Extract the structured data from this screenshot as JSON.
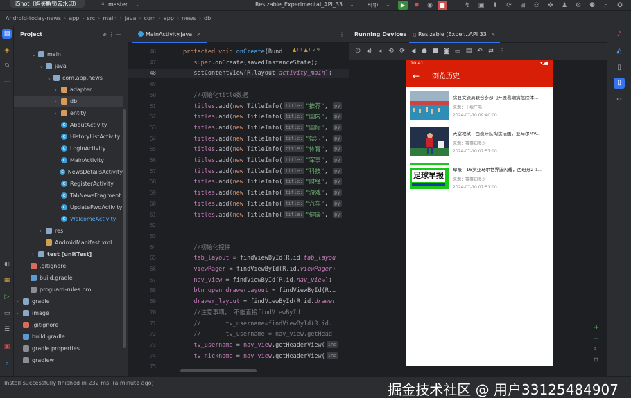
{
  "titlebar": {
    "chip": "iShot（购买解锁去水印）",
    "project_name": "Android-today-news",
    "branch": "master",
    "device": "Resizable_Experimental_API_33",
    "run_config": "app"
  },
  "breadcrumb": [
    "Android-today-news",
    "app",
    "src",
    "main",
    "java",
    "com",
    "app",
    "news",
    "db"
  ],
  "project_panel": {
    "title": "Project",
    "tree": [
      {
        "label": "main",
        "kind": "folder",
        "indent": 1,
        "open": true
      },
      {
        "label": "java",
        "kind": "folder",
        "indent": 2,
        "open": true
      },
      {
        "label": "com.app.news",
        "kind": "folder",
        "indent": 3,
        "open": true
      },
      {
        "label": "adapter",
        "kind": "folder-o",
        "indent": 4
      },
      {
        "label": "db",
        "kind": "folder-o",
        "indent": 4,
        "selected": true
      },
      {
        "label": "entity",
        "kind": "folder-o",
        "indent": 4
      },
      {
        "label": "AboutActivity",
        "kind": "class",
        "indent": 4
      },
      {
        "label": "HistoryListActivity",
        "kind": "class",
        "indent": 4
      },
      {
        "label": "LoginActivity",
        "kind": "class",
        "indent": 4
      },
      {
        "label": "MainActivity",
        "kind": "class",
        "indent": 4
      },
      {
        "label": "NewsDetailsActivity",
        "kind": "class",
        "indent": 4
      },
      {
        "label": "RegisterActivity",
        "kind": "class",
        "indent": 4
      },
      {
        "label": "TabNewsFragment",
        "kind": "class",
        "indent": 4
      },
      {
        "label": "UpdatePwdActivity",
        "kind": "class",
        "indent": 4
      },
      {
        "label": "WelcomeActivity",
        "kind": "class",
        "indent": 4,
        "accent": true
      },
      {
        "label": "res",
        "kind": "folder",
        "indent": 2
      },
      {
        "label": "AndroidManifest.xml",
        "kind": "xml",
        "indent": 2
      },
      {
        "label": "test [unitTest]",
        "kind": "folder",
        "indent": 1,
        "bold": true
      },
      {
        "label": ".gitignore",
        "kind": "git",
        "indent": 0
      },
      {
        "label": "build.gradle",
        "kind": "gradle",
        "indent": 0
      },
      {
        "label": "proguard-rules.pro",
        "kind": "txt",
        "indent": 0
      },
      {
        "label": "gradle",
        "kind": "folder",
        "indent": -1
      },
      {
        "label": "image",
        "kind": "folder",
        "indent": -1
      },
      {
        "label": ".gitignore",
        "kind": "git",
        "indent": -1
      },
      {
        "label": "build.gradle",
        "kind": "gradle",
        "indent": -1
      },
      {
        "label": "gradle.properties",
        "kind": "txt",
        "indent": -1
      },
      {
        "label": "gradlew",
        "kind": "txt",
        "indent": -1
      }
    ]
  },
  "editor": {
    "tab_label": "MainActivity.java",
    "inspection_counts": [
      "11",
      "1",
      "9"
    ],
    "lines": [
      {
        "num": "46",
        "html": "<span class='kw'>protected void</span> <span class='fn'>onCreate</span>(Bund"
      },
      {
        "num": "47",
        "html": "&nbsp;&nbsp;&nbsp;<span class='kw'>super</span>.onCreate(savedInstanceState);"
      },
      {
        "num": "48",
        "html": "&nbsp;&nbsp;&nbsp;setContentView(R.layout.<span class='it'>activity_main</span>);"
      },
      {
        "num": "49",
        "html": ""
      },
      {
        "num": "50",
        "html": "&nbsp;&nbsp;&nbsp;<span class='cmt'>//初始化title数据</span>"
      },
      {
        "num": "51",
        "html": "&nbsp;&nbsp;&nbsp;<span class='fld'>titles</span>.add(<span class='kw'>new</span> TitleInfo(<span class='hint'>title:</span><span class='str'>\"推荐\"</span>, <span class='hint'>py</span>"
      },
      {
        "num": "52",
        "html": "&nbsp;&nbsp;&nbsp;<span class='fld'>titles</span>.add(<span class='kw'>new</span> TitleInfo(<span class='hint'>title:</span><span class='str'>\"国内\"</span>, <span class='hint'>py</span>"
      },
      {
        "num": "53",
        "html": "&nbsp;&nbsp;&nbsp;<span class='fld'>titles</span>.add(<span class='kw'>new</span> TitleInfo(<span class='hint'>title:</span><span class='str'>\"国际\"</span>, <span class='hint'>py</span>"
      },
      {
        "num": "54",
        "html": "&nbsp;&nbsp;&nbsp;<span class='fld'>titles</span>.add(<span class='kw'>new</span> TitleInfo(<span class='hint'>title:</span><span class='str'>\"娱乐\"</span>, <span class='hint'>py</span>"
      },
      {
        "num": "55",
        "html": "&nbsp;&nbsp;&nbsp;<span class='fld'>titles</span>.add(<span class='kw'>new</span> TitleInfo(<span class='hint'>title:</span><span class='str'>\"体育\"</span>, <span class='hint'>py</span>"
      },
      {
        "num": "56",
        "html": "&nbsp;&nbsp;&nbsp;<span class='fld'>titles</span>.add(<span class='kw'>new</span> TitleInfo(<span class='hint'>title:</span><span class='str'>\"军事\"</span>, <span class='hint'>py</span>"
      },
      {
        "num": "57",
        "html": "&nbsp;&nbsp;&nbsp;<span class='fld'>titles</span>.add(<span class='kw'>new</span> TitleInfo(<span class='hint'>title:</span><span class='str'>\"科技\"</span>, <span class='hint'>py</span>"
      },
      {
        "num": "58",
        "html": "&nbsp;&nbsp;&nbsp;<span class='fld'>titles</span>.add(<span class='kw'>new</span> TitleInfo(<span class='hint'>title:</span><span class='str'>\"财经\"</span>, <span class='hint'>py</span>"
      },
      {
        "num": "59",
        "html": "&nbsp;&nbsp;&nbsp;<span class='fld'>titles</span>.add(<span class='kw'>new</span> TitleInfo(<span class='hint'>title:</span><span class='str'>\"游戏\"</span>, <span class='hint'>py</span>"
      },
      {
        "num": "60",
        "html": "&nbsp;&nbsp;&nbsp;<span class='fld'>titles</span>.add(<span class='kw'>new</span> TitleInfo(<span class='hint'>title:</span><span class='str'>\"汽车\"</span>, <span class='hint'>py</span>"
      },
      {
        "num": "61",
        "html": "&nbsp;&nbsp;&nbsp;<span class='fld'>titles</span>.add(<span class='kw'>new</span> TitleInfo(<span class='hint'>title:</span><span class='str'>\"健康\"</span>, <span class='hint'>py</span>"
      },
      {
        "num": "62",
        "html": ""
      },
      {
        "num": "63",
        "html": ""
      },
      {
        "num": "64",
        "html": "&nbsp;&nbsp;&nbsp;<span class='cmt'>//初始化控件</span>"
      },
      {
        "num": "65",
        "html": "&nbsp;&nbsp;&nbsp;<span class='fld'>tab_layout</span> = findViewById(R.id.<span class='it'>tab_layou</span>"
      },
      {
        "num": "66",
        "html": "&nbsp;&nbsp;&nbsp;<span class='fld'>viewPager</span> = findViewById(R.id.<span class='it'>viewPager</span>)"
      },
      {
        "num": "67",
        "html": "&nbsp;&nbsp;&nbsp;<span class='fld'>nav_view</span> = findViewById(R.id.<span class='it'>nav_view</span>);"
      },
      {
        "num": "68",
        "html": "&nbsp;&nbsp;&nbsp;<span class='fld'>btn_open_drawerLayout</span> = findViewById(R.i"
      },
      {
        "num": "69",
        "html": "&nbsp;&nbsp;&nbsp;<span class='fld'>drawer_layout</span> = findViewById(R.id.<span class='it'>drawer</span>"
      },
      {
        "num": "70",
        "html": "&nbsp;&nbsp;&nbsp;<span class='cmt'>//注意事项， 不能直接findViewById</span>"
      },
      {
        "num": "71",
        "html": "&nbsp;&nbsp;&nbsp;<span class='cmt'>//&nbsp;&nbsp;&nbsp;&nbsp;&nbsp;&nbsp;&nbsp;tv_username=findViewById(R.id.</span>"
      },
      {
        "num": "72",
        "html": "&nbsp;&nbsp;&nbsp;<span class='cmt'>//&nbsp;&nbsp;&nbsp;&nbsp;&nbsp;&nbsp;&nbsp;tv_username = nav_view.getHead</span>"
      },
      {
        "num": "73",
        "html": "&nbsp;&nbsp;&nbsp;<span class='fld'>tv_username</span> = <span class='fld'>nav_view</span>.getHeaderView(<span class='hint'>ind</span>"
      },
      {
        "num": "74",
        "html": "&nbsp;&nbsp;&nbsp;<span class='fld'>tv_nickname</span> = <span class='fld'>nav_view</span>.getHeaderView(<span class='hint'>ind</span>"
      },
      {
        "num": "75",
        "html": ""
      }
    ]
  },
  "running_devices": {
    "title": "Running Devices",
    "tab_label": "Resizable (Exper...API 33"
  },
  "phone": {
    "time": "10:41",
    "title": "浏览历史",
    "news": [
      {
        "title": "房县文旅局联合多部门开展暑期病危险体...",
        "source": "来源：十堰广电",
        "time": "2024-07-10 09:40:00",
        "thumb": "pool"
      },
      {
        "title": "天堂地狱！西班牙队淘汰法国，亚马尔MV...",
        "source": "来源：赛事知多少",
        "time": "2024-07-10 07:57:00",
        "thumb": "soccer"
      },
      {
        "title": "早报：16岁亚马尔世界波闪耀，西班牙2-1...",
        "source": "来源：赛事知多少",
        "time": "2024-07-10 07:51:00",
        "thumb": "board"
      }
    ],
    "board_text": "足球早报"
  },
  "statusbar": {
    "message": "Install successfully finished in 232 ms. (a minute ago)",
    "watermark": "掘金技术社区 @ 用户3312548490​7"
  },
  "colors": {
    "accent_blue": "#3574f0",
    "app_red": "#d81e06",
    "ide_bg": "#1e1f22",
    "panel_bg": "#2b2d30"
  }
}
